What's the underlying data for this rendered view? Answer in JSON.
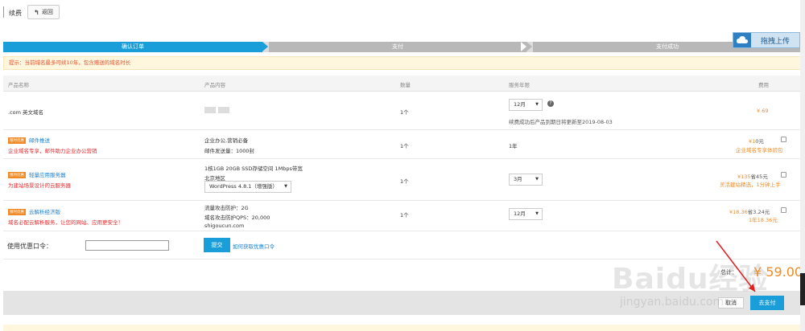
{
  "topbar": {
    "title": "续费",
    "back_label": "返回"
  },
  "steps": [
    "确认订单",
    "支付",
    "支付成功"
  ],
  "upload": {
    "label": "拖拽上传"
  },
  "notice": {
    "prefix": "提示：",
    "text": "当前域名最多可续10年，包含赠送的域名时长"
  },
  "table": {
    "headers": {
      "name": "产品名称",
      "content": "产品内容",
      "qty": "数量",
      "period": "服务年限",
      "fee": "费用"
    },
    "rows": [
      {
        "name": ".com 英文域名",
        "qty": "1个",
        "period": "12月",
        "period_note": "续费成功后产品到期日将更新至2019-08-03",
        "price": "¥ 69"
      },
      {
        "badge": "限时优惠",
        "name": "邮件推送",
        "desc": "企业域名专享，邮件助力企业办公营销",
        "content1": "企业办公,营销必备",
        "content2": "邮件发送量：1000封",
        "qty": "1个",
        "period": "1年",
        "price": "¥1",
        "price_old": "0元",
        "promo": "企业域名专享体验包"
      },
      {
        "badge": "限时优惠",
        "name": "轻量应用服务器",
        "desc": "为建站场景设计的云服务器",
        "content1": "1核1GB 20GB SSD存储空间 1Mbps带宽",
        "content2": "北京地区",
        "image_select": "WordPress 4.8.1（增强版）",
        "qty": "1个",
        "period": "3月",
        "price": "¥135",
        "price_old": "省45元",
        "promo": "灵活建站精选，1分钟上手"
      },
      {
        "badge": "限时优惠",
        "name": "云解析经济版",
        "desc": "域名必配云解析服务，让您的网站、应用更安全！",
        "content1": "流量攻击防护：2G",
        "content2": "域名攻击防护QPS：20,000",
        "content3": "shigoucun.com",
        "qty": "1个",
        "period": "12月",
        "price": "¥18.36",
        "price_old": "省3.24元",
        "promo": "1年18.36元"
      }
    ]
  },
  "coupon": {
    "label": "使用优惠口令：",
    "input_value": "",
    "submit": "提交",
    "link": "如何获取优惠口令"
  },
  "total": {
    "prefix": "总计：",
    "amount": "¥ 59.00"
  },
  "footer": {
    "cancel": "取消",
    "pay": "去支付"
  },
  "watermark": {
    "main": "Baidu经验",
    "sub": "jingyan.baidu.com"
  }
}
